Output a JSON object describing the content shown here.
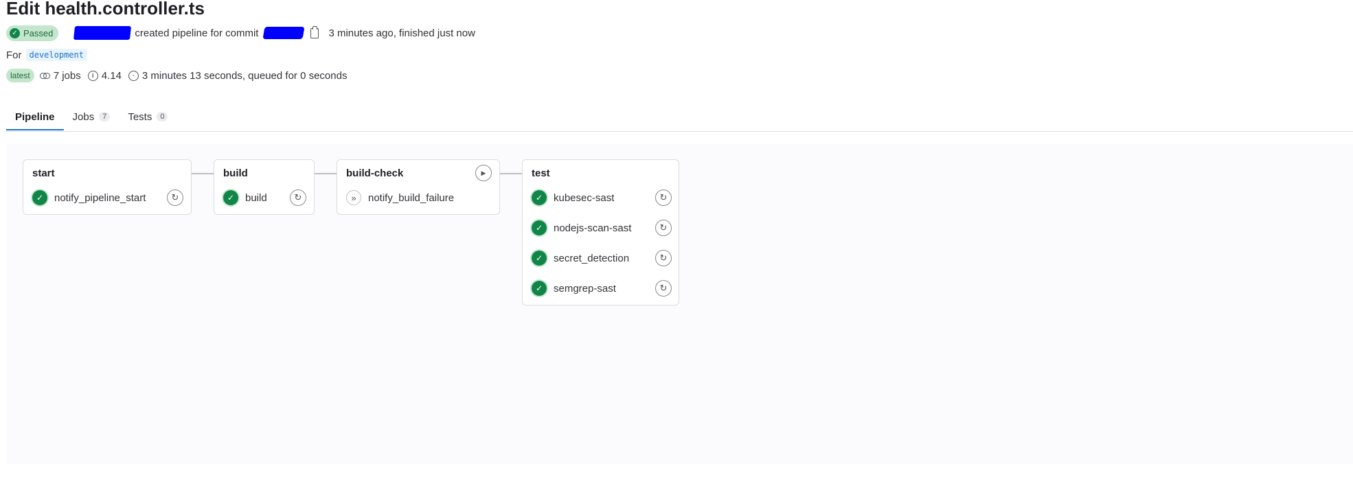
{
  "header": {
    "title": "Edit health.controller.ts",
    "status_label": "Passed",
    "created_text": "created pipeline for commit",
    "time_text": "3 minutes ago, finished just now",
    "for_label": "For",
    "branch": "development",
    "latest_label": "latest",
    "jobs_count": "7 jobs",
    "version": "4.14",
    "duration": "3 minutes 13 seconds, queued for 0 seconds"
  },
  "tabs": [
    {
      "label": "Pipeline",
      "count": ""
    },
    {
      "label": "Jobs",
      "count": "7"
    },
    {
      "label": "Tests",
      "count": "0"
    }
  ],
  "stages": [
    {
      "name": "start",
      "jobs": [
        {
          "name": "notify_pipeline_start",
          "status": "passed",
          "action": "retry"
        }
      ]
    },
    {
      "name": "build",
      "jobs": [
        {
          "name": "build",
          "status": "passed",
          "action": "retry"
        }
      ]
    },
    {
      "name": "build-check",
      "jobs": [
        {
          "name": "notify_build_failure",
          "status": "skipped",
          "action": "none"
        }
      ],
      "stage_action": "play"
    },
    {
      "name": "test",
      "jobs": [
        {
          "name": "kubesec-sast",
          "status": "passed",
          "action": "retry"
        },
        {
          "name": "nodejs-scan-sast",
          "status": "passed",
          "action": "retry"
        },
        {
          "name": "secret_detection",
          "status": "passed",
          "action": "retry"
        },
        {
          "name": "semgrep-sast",
          "status": "passed",
          "action": "retry"
        }
      ]
    }
  ],
  "icons": {
    "status": "check-circle-icon",
    "copy": "clipboard-icon",
    "jobs": "link-icon",
    "version": "info-icon",
    "duration": "timer-icon",
    "retry": "retry-icon",
    "play": "play-icon",
    "skipped": "skipped-icon"
  },
  "colors": {
    "success": "#108548",
    "success_bg": "#c3e6cd",
    "link": "#1f75cb",
    "redaction": "#0000ff"
  }
}
